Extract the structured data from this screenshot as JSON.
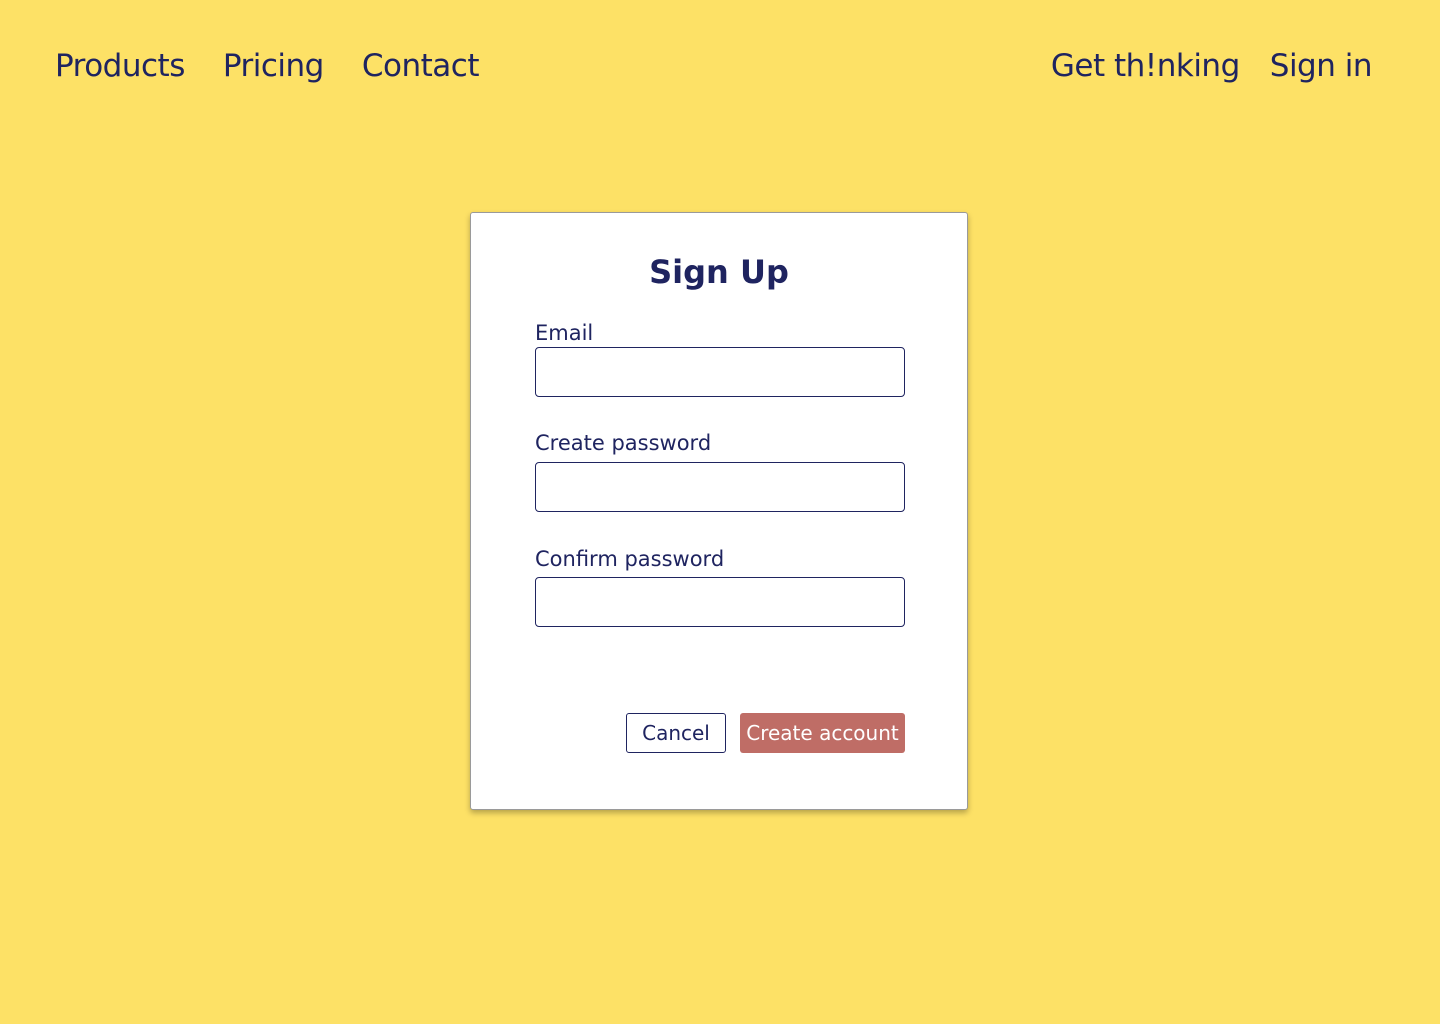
{
  "nav": {
    "left_links": [
      "Products",
      "Pricing",
      "Contact"
    ],
    "get_thinking": "Get th!nking",
    "sign_in": "Sign in"
  },
  "form": {
    "title": "Sign Up",
    "email_label": "Email",
    "email_value": "",
    "password_label": "Create password",
    "password_value": "",
    "confirm_label": "Confirm password",
    "confirm_value": "",
    "cancel_label": "Cancel",
    "submit_label": "Create account"
  },
  "colors": {
    "background": "#fde166",
    "text": "#1f2460",
    "card": "#ffffff",
    "primary_button": "#bf6d66"
  }
}
